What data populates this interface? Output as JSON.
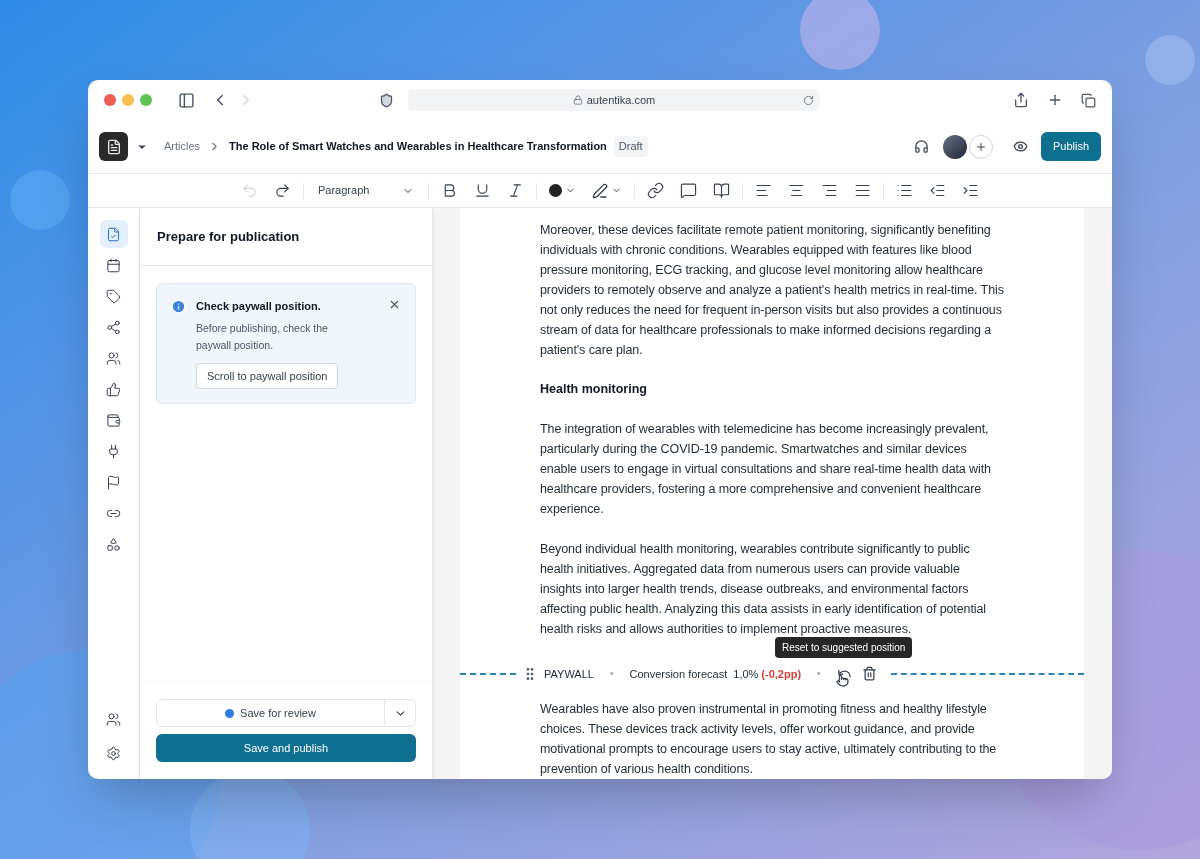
{
  "browser": {
    "url": "autentika.com"
  },
  "header": {
    "breadcrumb": "Articles",
    "title": "The Role of Smart Watches and Wearables in Healthcare Transformation",
    "status": "Draft",
    "publish": "Publish"
  },
  "toolbar": {
    "undo_disabled": true,
    "block_style": "Paragraph"
  },
  "rail": {
    "items": [
      {
        "selected": true
      },
      {
        "selected": false
      },
      {
        "selected": false
      },
      {
        "selected": false
      },
      {
        "selected": false
      },
      {
        "selected": false
      },
      {
        "selected": false
      },
      {
        "selected": false
      },
      {
        "selected": false
      },
      {
        "selected": false
      },
      {
        "selected": false
      }
    ]
  },
  "panel": {
    "title": "Prepare for publication",
    "notice": {
      "title": "Check paywall position.",
      "body": "Before publishing, check the paywall position.",
      "button": "Scroll to paywall position"
    },
    "save_review": {
      "label": "Save for review",
      "color": "#2f7fe0"
    },
    "save_publish": "Save and publish"
  },
  "article": {
    "blocks": [
      {
        "kind": "paragraph",
        "text": "Moreover, these devices facilitate remote patient monitoring, significantly benefiting individuals with chronic conditions. Wearables equipped with features like blood pressure monitoring, ECG tracking, and glucose level monitoring allow healthcare providers to remotely observe and analyze a patient's health metrics in real-time. This not only reduces the need for frequent in-person visits but also provides a continuous stream of data for healthcare professionals to make informed decisions regarding a patient's care plan."
      },
      {
        "kind": "heading",
        "text": "Health monitoring"
      },
      {
        "kind": "paragraph",
        "text": "The integration of wearables with telemedicine has become increasingly prevalent, particularly during the COVID-19 pandemic. Smartwatches and similar devices enable users to engage in virtual consultations and share real-time health data with healthcare providers, fostering a more comprehensive and convenient healthcare experience."
      },
      {
        "kind": "paragraph",
        "text": "Beyond individual health monitoring, wearables contribute significantly to public health initiatives. Aggregated data from numerous users can provide valuable insights into larger health trends, disease outbreaks, and environmental factors affecting public health. Analyzing this data assists in early identification of potential health risks and allows authorities to implement proactive measures."
      },
      {
        "kind": "paywall",
        "label": "PAYWALL",
        "forecast_label": "Conversion forecast",
        "forecast_value": "1,0%",
        "forecast_change": "(-0,2pp)",
        "separator": "•",
        "tooltip": "Reset to suggested position"
      },
      {
        "kind": "paragraph",
        "text": "Wearables have also proven instrumental in promoting fitness and healthy lifestyle choices. These devices track activity levels, offer workout guidance, and provide motivational prompts to encourage users to stay active, ultimately contributing to the prevention of various health conditions."
      }
    ]
  }
}
